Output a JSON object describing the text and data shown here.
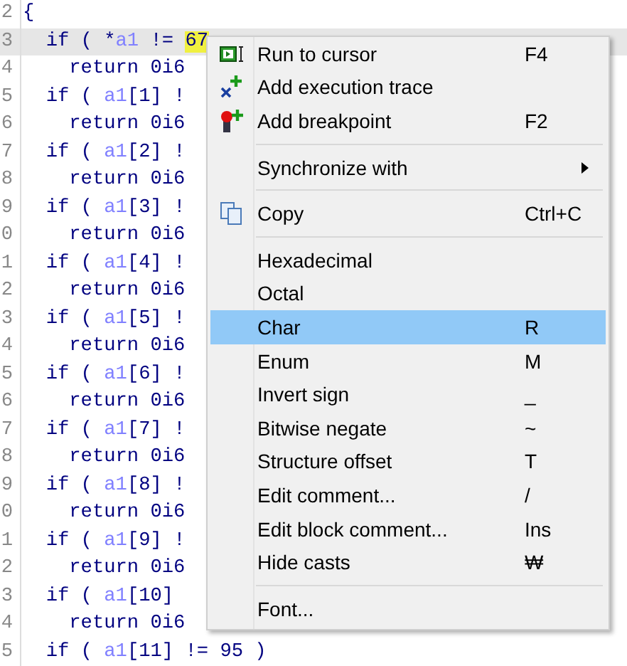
{
  "editor": {
    "lines": [
      {
        "number": "2",
        "current": false,
        "segments": [
          {
            "kind": "plain",
            "text": "{"
          }
        ]
      },
      {
        "number": "3",
        "current": true,
        "segments": [
          {
            "kind": "plain",
            "text": "  if ( *"
          },
          {
            "kind": "var",
            "text": "a1"
          },
          {
            "kind": "plain",
            "text": " != "
          },
          {
            "kind": "match",
            "text": "67"
          }
        ]
      },
      {
        "number": "4",
        "current": false,
        "segments": [
          {
            "kind": "plain",
            "text": "    return 0i6"
          }
        ]
      },
      {
        "number": "5",
        "current": false,
        "segments": [
          {
            "kind": "plain",
            "text": "  if ( "
          },
          {
            "kind": "var",
            "text": "a1"
          },
          {
            "kind": "plain",
            "text": "[1] !"
          }
        ]
      },
      {
        "number": "6",
        "current": false,
        "segments": [
          {
            "kind": "plain",
            "text": "    return 0i6"
          }
        ]
      },
      {
        "number": "7",
        "current": false,
        "segments": [
          {
            "kind": "plain",
            "text": "  if ( "
          },
          {
            "kind": "var",
            "text": "a1"
          },
          {
            "kind": "plain",
            "text": "[2] !"
          }
        ]
      },
      {
        "number": "8",
        "current": false,
        "segments": [
          {
            "kind": "plain",
            "text": "    return 0i6"
          }
        ]
      },
      {
        "number": "9",
        "current": false,
        "segments": [
          {
            "kind": "plain",
            "text": "  if ( "
          },
          {
            "kind": "var",
            "text": "a1"
          },
          {
            "kind": "plain",
            "text": "[3] !"
          }
        ]
      },
      {
        "number": "0",
        "current": false,
        "segments": [
          {
            "kind": "plain",
            "text": "    return 0i6"
          }
        ]
      },
      {
        "number": "1",
        "current": false,
        "segments": [
          {
            "kind": "plain",
            "text": "  if ( "
          },
          {
            "kind": "var",
            "text": "a1"
          },
          {
            "kind": "plain",
            "text": "[4] !"
          }
        ]
      },
      {
        "number": "2",
        "current": false,
        "segments": [
          {
            "kind": "plain",
            "text": "    return 0i6"
          }
        ]
      },
      {
        "number": "3",
        "current": false,
        "segments": [
          {
            "kind": "plain",
            "text": "  if ( "
          },
          {
            "kind": "var",
            "text": "a1"
          },
          {
            "kind": "plain",
            "text": "[5] !"
          }
        ]
      },
      {
        "number": "4",
        "current": false,
        "segments": [
          {
            "kind": "plain",
            "text": "    return 0i6"
          }
        ]
      },
      {
        "number": "5",
        "current": false,
        "segments": [
          {
            "kind": "plain",
            "text": "  if ( "
          },
          {
            "kind": "var",
            "text": "a1"
          },
          {
            "kind": "plain",
            "text": "[6] !"
          }
        ]
      },
      {
        "number": "6",
        "current": false,
        "segments": [
          {
            "kind": "plain",
            "text": "    return 0i6"
          }
        ]
      },
      {
        "number": "7",
        "current": false,
        "segments": [
          {
            "kind": "plain",
            "text": "  if ( "
          },
          {
            "kind": "var",
            "text": "a1"
          },
          {
            "kind": "plain",
            "text": "[7] !"
          }
        ]
      },
      {
        "number": "8",
        "current": false,
        "segments": [
          {
            "kind": "plain",
            "text": "    return 0i6"
          }
        ]
      },
      {
        "number": "9",
        "current": false,
        "segments": [
          {
            "kind": "plain",
            "text": "  if ( "
          },
          {
            "kind": "var",
            "text": "a1"
          },
          {
            "kind": "plain",
            "text": "[8] !"
          }
        ]
      },
      {
        "number": "0",
        "current": false,
        "segments": [
          {
            "kind": "plain",
            "text": "    return 0i6"
          }
        ]
      },
      {
        "number": "1",
        "current": false,
        "segments": [
          {
            "kind": "plain",
            "text": "  if ( "
          },
          {
            "kind": "var",
            "text": "a1"
          },
          {
            "kind": "plain",
            "text": "[9] !"
          }
        ]
      },
      {
        "number": "2",
        "current": false,
        "segments": [
          {
            "kind": "plain",
            "text": "    return 0i6"
          }
        ]
      },
      {
        "number": "3",
        "current": false,
        "segments": [
          {
            "kind": "plain",
            "text": "  if ( "
          },
          {
            "kind": "var",
            "text": "a1"
          },
          {
            "kind": "plain",
            "text": "[10]"
          }
        ]
      },
      {
        "number": "4",
        "current": false,
        "segments": [
          {
            "kind": "plain",
            "text": "    return 0i6"
          }
        ]
      },
      {
        "number": "5",
        "current": false,
        "segments": [
          {
            "kind": "plain",
            "text": "  if ( "
          },
          {
            "kind": "var",
            "text": "a1"
          },
          {
            "kind": "plain",
            "text": "[11] != 95 )"
          }
        ]
      }
    ]
  },
  "context_menu": {
    "items": [
      {
        "kind": "item",
        "label": "Run to cursor",
        "shortcut": "F4",
        "selected": false
      },
      {
        "kind": "item",
        "label": "Add execution trace",
        "selected": false
      },
      {
        "kind": "item",
        "label": "Add breakpoint",
        "shortcut": "F2",
        "selected": false
      },
      {
        "kind": "separator"
      },
      {
        "kind": "submenu",
        "label": "Synchronize with",
        "selected": false
      },
      {
        "kind": "separator"
      },
      {
        "kind": "item",
        "label": "Copy",
        "shortcut": "Ctrl+C",
        "selected": false
      },
      {
        "kind": "separator"
      },
      {
        "kind": "item",
        "label": "Hexadecimal",
        "selected": false
      },
      {
        "kind": "item",
        "label": "Octal",
        "selected": false
      },
      {
        "kind": "item",
        "label": "Char",
        "shortcut": "R",
        "selected": true
      },
      {
        "kind": "item",
        "label": "Enum",
        "shortcut": "M",
        "selected": false
      },
      {
        "kind": "item",
        "label": "Invert sign",
        "shortcut": "_",
        "selected": false
      },
      {
        "kind": "item",
        "label": "Bitwise negate",
        "shortcut": "~",
        "selected": false
      },
      {
        "kind": "item",
        "label": "Structure offset",
        "shortcut": "T",
        "selected": false
      },
      {
        "kind": "item",
        "label": "Edit comment...",
        "shortcut": "/",
        "selected": false
      },
      {
        "kind": "item",
        "label": "Edit block comment...",
        "shortcut": "Ins",
        "selected": false
      },
      {
        "kind": "item",
        "label": "Hide casts",
        "shortcut": "₩",
        "selected": false
      },
      {
        "kind": "separator"
      },
      {
        "kind": "item",
        "label": "Font...",
        "selected": false
      }
    ]
  }
}
